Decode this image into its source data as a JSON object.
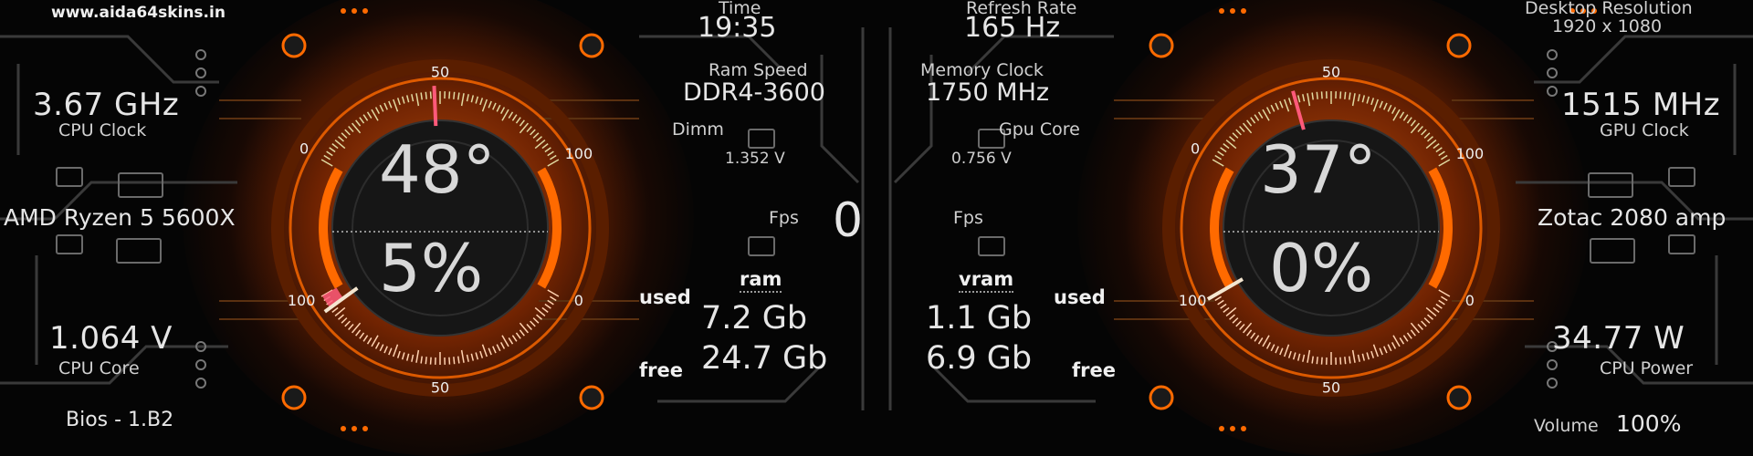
{
  "site": "www.aida64skins.in",
  "center": {
    "time_label": "Time",
    "time_value": "19:35",
    "refresh_label": "Refresh Rate",
    "refresh_value": "165 Hz",
    "ramspeed_label": "Ram Speed",
    "ramspeed_value": "DDR4-3600",
    "memclock_label": "Memory Clock",
    "memclock_value": "1750 MHz",
    "dimm_label": "Dimm",
    "dimm_value": "1.352 V",
    "gpucore_label": "Gpu Core",
    "gpucore_value": "0.756 V",
    "fps_left_label": "Fps",
    "fps_right_label": "Fps",
    "fps_value": "0",
    "ram_label": "ram",
    "vram_label": "vram",
    "used_label_left": "used",
    "free_label_left": "free",
    "used_label_right": "used",
    "free_label_right": "free",
    "ram_used": "7.2 Gb",
    "ram_free": "24.7 Gb",
    "vram_used": "1.1 Gb",
    "vram_free": "6.9 Gb"
  },
  "left": {
    "clock_value": "3.67 GHz",
    "clock_label": "CPU Clock",
    "cpu_name": "AMD Ryzen 5 5600X",
    "core_value": "1.064 V",
    "core_label": "CPU Core",
    "bios": "Bios - 1.B2",
    "temp": "48°",
    "load": "5%",
    "temp_fraction": 0.48,
    "load_fraction": 0.05,
    "ticks": [
      "0",
      "50",
      "100",
      "100",
      "50",
      "0"
    ]
  },
  "right": {
    "resolution_label": "Desktop Resolution",
    "resolution_value": "1920 x 1080",
    "clock_value": "1515 MHz",
    "clock_label": "GPU Clock",
    "gpu_name": "Zotac 2080 amp",
    "power_value": "34.77 W",
    "power_label": "CPU Power",
    "volume_label": "Volume",
    "volume_value": "100%",
    "temp": "37°",
    "load": "0%",
    "temp_fraction": 0.37,
    "load_fraction": 0.0,
    "ticks": [
      "0",
      "50",
      "100",
      "100",
      "50",
      "0"
    ]
  },
  "colors": {
    "accent_orange": "#ff6a00",
    "deep_orange": "#8a2a00",
    "pink_needle": "#ff5a7a",
    "dial_dark": "#161616"
  }
}
